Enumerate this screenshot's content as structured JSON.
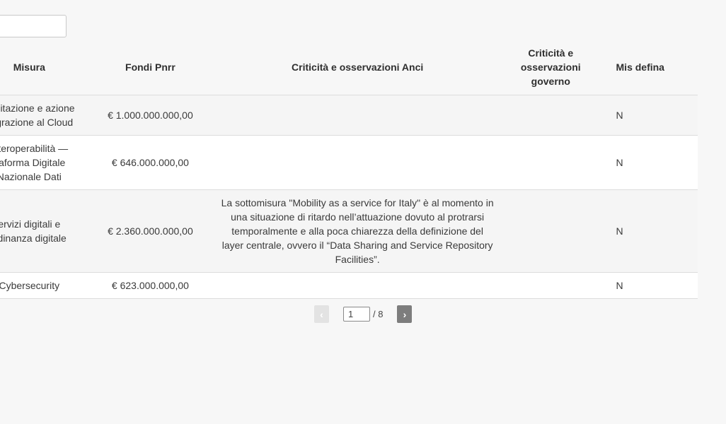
{
  "search": {
    "placeholder": ""
  },
  "table": {
    "headers": {
      "misura": "Misura",
      "fondi": "Fondi Pnrr",
      "anci": "Criticità e osservazioni Anci",
      "governo": "Criticità e osservazioni governo",
      "definizione": "Mis defina"
    },
    "rows": [
      {
        "misura": "Abilitazione e azione migrazione al Cloud",
        "fondi": "€ 1.000.000.000,00",
        "anci": "",
        "governo": "",
        "definizione": "N"
      },
      {
        "misura": "interoperabilità — ttaforma Digitale Nazionale Dati",
        "fondi": "€ 646.000.000,00",
        "anci": "",
        "governo": "",
        "definizione": "N"
      },
      {
        "misura": "ervizi digitali e adinanza digitale",
        "fondi": "€ 2.360.000.000,00",
        "anci": "La sottomisura \"Mobility as a service for Italy\" è al momento in una situazione di ritardo nell’attuazione dovuto al protrarsi temporalmente e alla poca chiarezza della definizione del layer centrale, ovvero il “Data Sharing and Service Repository Facilities”.",
        "governo": "",
        "definizione": "N"
      },
      {
        "misura": "Cybersecurity",
        "fondi": "€ 623.000.000,00",
        "anci": "",
        "governo": "",
        "definizione": "N"
      }
    ]
  },
  "pagination": {
    "prev_label": "‹",
    "next_label": "›",
    "current_page": "1",
    "total_label": "/ 8"
  }
}
